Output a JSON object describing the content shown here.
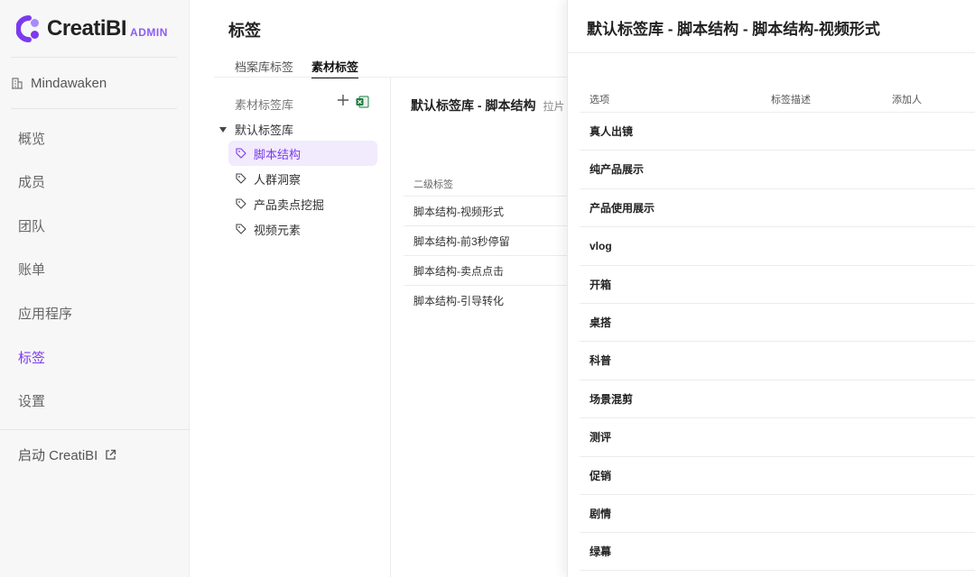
{
  "brand": {
    "name": "CreatiBI",
    "suffix": "ADMIN",
    "accent": "#7c3aed"
  },
  "org": "Mindawaken",
  "nav": [
    {
      "label": "概览",
      "active": false
    },
    {
      "label": "成员",
      "active": false
    },
    {
      "label": "团队",
      "active": false
    },
    {
      "label": "账单",
      "active": false
    },
    {
      "label": "应用程序",
      "active": false
    },
    {
      "label": "标签",
      "active": true
    },
    {
      "label": "设置",
      "active": false
    }
  ],
  "launch": "启动 CreatiBI",
  "page": {
    "title": "标签",
    "tabs": [
      {
        "label": "档案库标签",
        "active": false
      },
      {
        "label": "素材标签",
        "active": true
      }
    ]
  },
  "tree": {
    "header": "素材标签库",
    "root": "默认标签库",
    "items": [
      {
        "label": "脚本结构",
        "active": true
      },
      {
        "label": "人群洞察",
        "active": false
      },
      {
        "label": "产品卖点挖掘",
        "active": false
      },
      {
        "label": "视频元素",
        "active": false
      }
    ]
  },
  "detail": {
    "title": "默认标签库 - 脚本结构",
    "subtitle": "拉片",
    "column": "二级标签",
    "rows": [
      "脚本结构-视频形式",
      "脚本结构-前3秒停留",
      "脚本结构-卖点点击",
      "脚本结构-引导转化"
    ]
  },
  "drawer": {
    "title": "默认标签库 - 脚本结构 - 脚本结构-视频形式",
    "columns": [
      "选项",
      "标签描述",
      "添加人"
    ],
    "options": [
      "真人出镜",
      "纯产品展示",
      "产品使用展示",
      "vlog",
      "开箱",
      "桌搭",
      "科普",
      "场景混剪",
      "测评",
      "促销",
      "剧情",
      "绿幕"
    ]
  }
}
